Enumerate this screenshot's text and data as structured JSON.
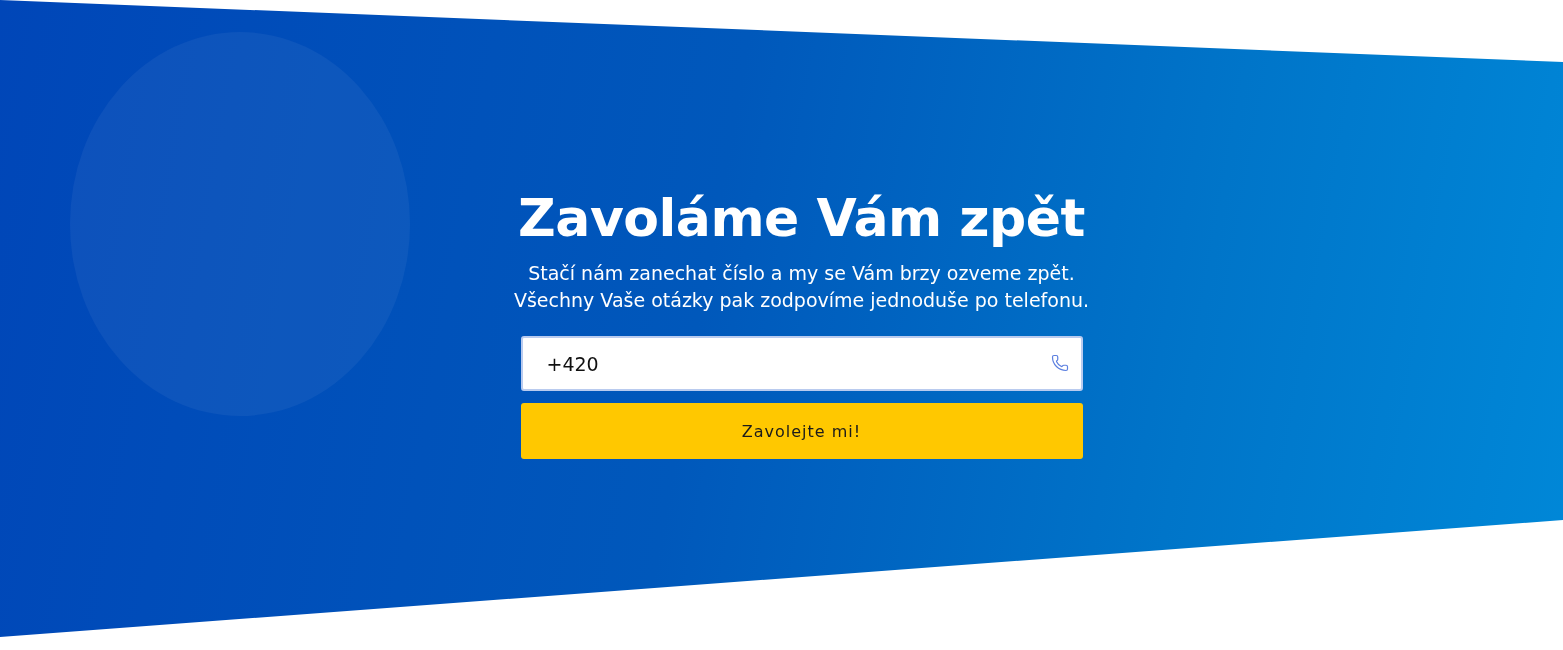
{
  "hero": {
    "title": "Zavoláme Vám zpět",
    "subtitle_lines": [
      "Stačí nám zanechat číslo a my se Vám brzy ozveme zpět.",
      "Všechny Vaše otázky pak zodpovíme jednoduše po telefonu."
    ],
    "phone_field": {
      "value": "+420"
    },
    "submit_button": {
      "label": "Zavolejte mi!"
    }
  }
}
